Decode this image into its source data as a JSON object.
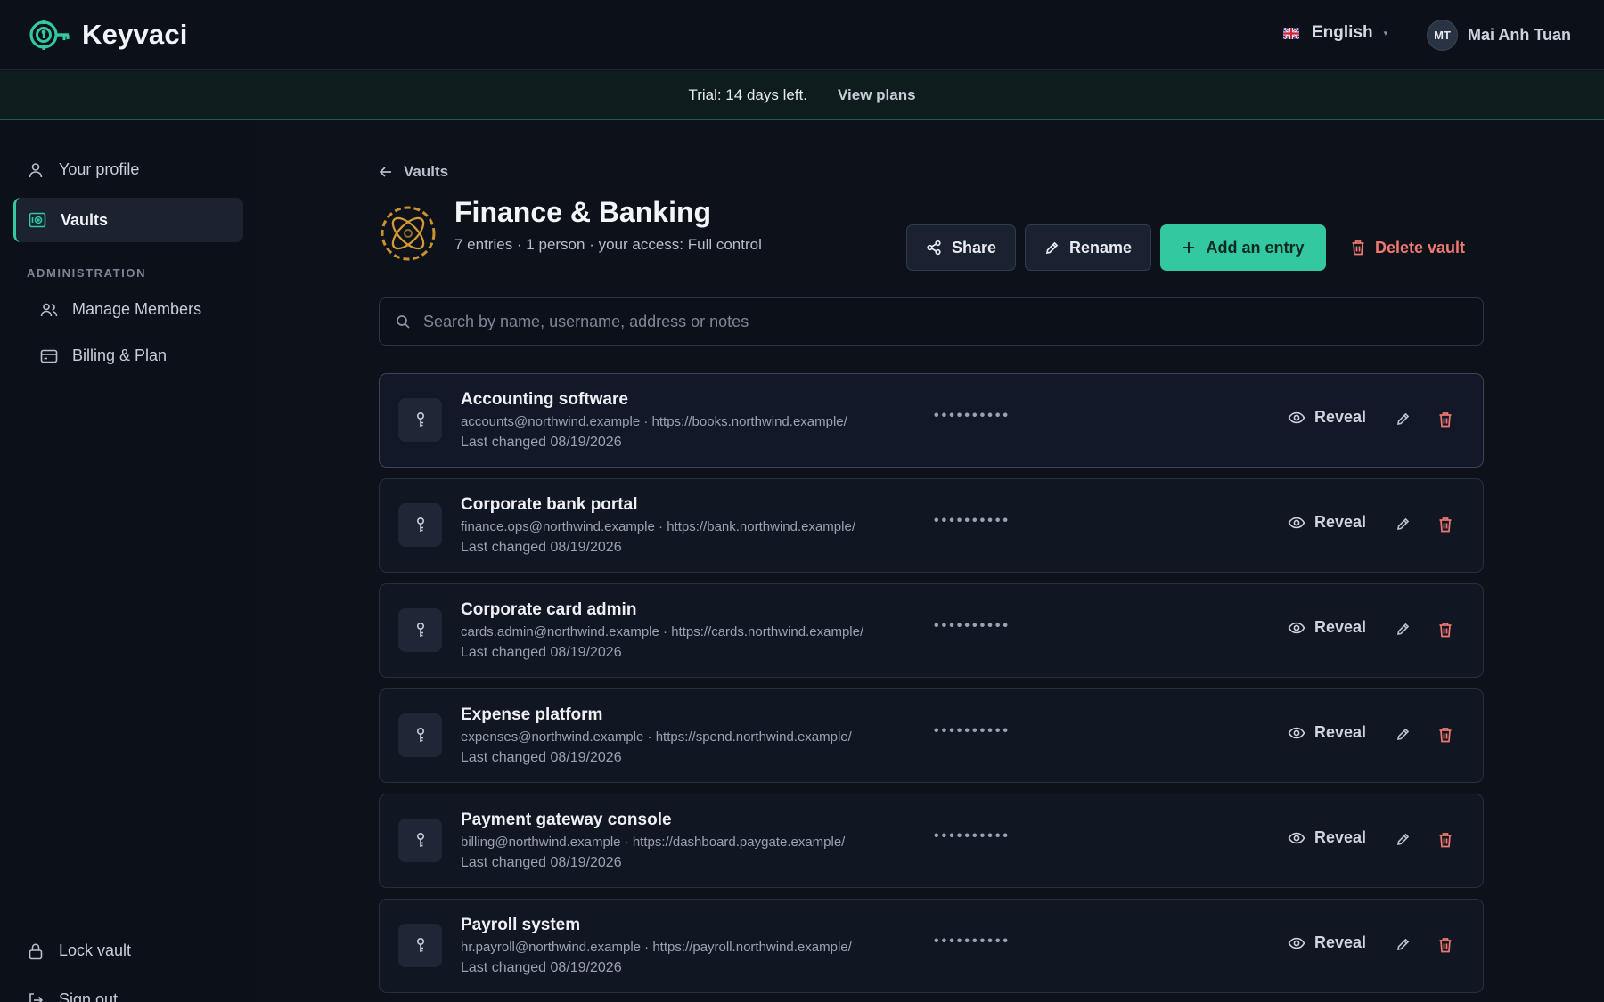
{
  "app": {
    "name": "Keyvaci"
  },
  "header": {
    "language": "English",
    "user": {
      "initials": "MT",
      "name": "Mai Anh Tuan"
    }
  },
  "banner": {
    "text": "Trial: 14 days left.",
    "link": "View plans"
  },
  "sidebar": {
    "items": [
      {
        "label": "Your profile",
        "icon": "user-icon"
      },
      {
        "label": "Vaults",
        "icon": "vault-icon",
        "active": true
      }
    ],
    "admin_section": "ADMINISTRATION",
    "admin_items": [
      {
        "label": "Manage Members",
        "icon": "users-icon"
      },
      {
        "label": "Billing & Plan",
        "icon": "credit-card-icon"
      }
    ],
    "footer": [
      {
        "label": "Lock vault",
        "icon": "lock-icon"
      },
      {
        "label": "Sign out",
        "icon": "sign-out-icon"
      }
    ]
  },
  "main": {
    "breadcrumb": "Vaults",
    "vault": {
      "title": "Finance & Banking",
      "meta": "7 entries · 1 person · your access: Full control"
    },
    "actions": {
      "share": "Share",
      "rename": "Rename",
      "add": "Add an entry",
      "delete": "Delete vault"
    },
    "search": {
      "placeholder": "Search by name, username, address or notes",
      "value": ""
    },
    "entries": [
      {
        "name": "Accounting software",
        "username": "accounts@northwind.example",
        "url": "https://books.northwind.example/",
        "changed": "Last changed 08/19/2026",
        "masked": "••••••••••",
        "reveal": "Reveal"
      },
      {
        "name": "Corporate bank portal",
        "username": "finance.ops@northwind.example",
        "url": "https://bank.northwind.example/",
        "changed": "Last changed 08/19/2026",
        "masked": "••••••••••",
        "reveal": "Reveal"
      },
      {
        "name": "Corporate card admin",
        "username": "cards.admin@northwind.example",
        "url": "https://cards.northwind.example/",
        "changed": "Last changed 08/19/2026",
        "masked": "••••••••••",
        "reveal": "Reveal"
      },
      {
        "name": "Expense platform",
        "username": "expenses@northwind.example",
        "url": "https://spend.northwind.example/",
        "changed": "Last changed 08/19/2026",
        "masked": "••••••••••",
        "reveal": "Reveal"
      },
      {
        "name": "Payment gateway console",
        "username": "billing@northwind.example",
        "url": "https://dashboard.paygate.example/",
        "changed": "Last changed 08/19/2026",
        "masked": "••••••••••",
        "reveal": "Reveal"
      },
      {
        "name": "Payroll system",
        "username": "hr.payroll@northwind.example",
        "url": "https://payroll.northwind.example/",
        "changed": "Last changed 08/19/2026",
        "masked": "••••••••••",
        "reveal": "Reveal"
      }
    ]
  },
  "colors": {
    "accent": "#33c89f",
    "danger": "#f07970",
    "background": "#0d111a",
    "banner": "#0f1c1d"
  }
}
